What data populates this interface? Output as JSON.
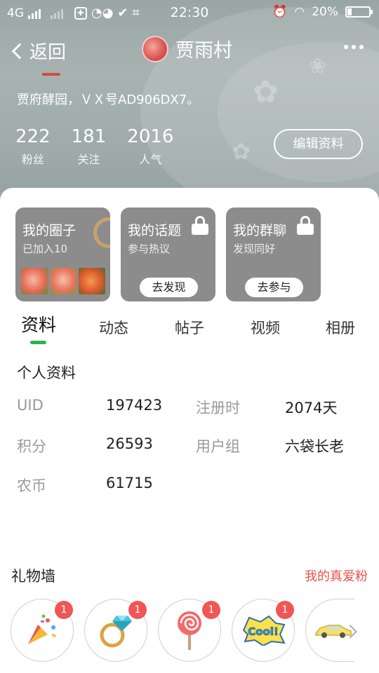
{
  "status_bar": {
    "network": "4G",
    "time": "22:30",
    "battery_text": "20%",
    "battery_level": 0.2
  },
  "navbar": {
    "back_label": "返回",
    "title": "贾雨村"
  },
  "profile": {
    "bio": "贾府酵园，ＶＸ号AD906DX7。",
    "stats": [
      {
        "value": "222",
        "label": "粉丝"
      },
      {
        "value": "181",
        "label": "关注"
      },
      {
        "value": "2016",
        "label": "人气"
      }
    ],
    "edit_button": "编辑资料"
  },
  "cards": [
    {
      "title": "我的圈子",
      "subtitle": "已加入10"
    },
    {
      "title": "我的话题",
      "subtitle": "参与热议",
      "button": "去发现"
    },
    {
      "title": "我的群聊",
      "subtitle": "发现同好",
      "button": "去参与"
    }
  ],
  "tabs": [
    "资料",
    "动态",
    "帖子",
    "视频",
    "相册"
  ],
  "active_tab": "资料",
  "personal_info": {
    "title": "个人资料",
    "fields": [
      {
        "key": "UID",
        "value": "197423"
      },
      {
        "key": "注册时",
        "value": "2074天"
      },
      {
        "key": "积分",
        "value": "26593"
      },
      {
        "key": "用户组",
        "value": "六袋长老"
      },
      {
        "key": "农币",
        "value": "61715"
      }
    ]
  },
  "gift_wall": {
    "title": "礼物墙",
    "link": "我的真爱粉",
    "gifts": [
      {
        "icon": "party-popper-icon",
        "count": "1"
      },
      {
        "icon": "diamond-ring-icon",
        "count": "1"
      },
      {
        "icon": "lollipop-icon",
        "count": "1"
      },
      {
        "icon": "cool-sticker-icon",
        "count": "1"
      },
      {
        "icon": "sports-car-icon",
        "count": ""
      }
    ]
  },
  "colors": {
    "accent_green": "#28b44a",
    "link_red": "#e8514b",
    "badge_red": "#f05656",
    "card_gray": "#8c8c8c"
  }
}
